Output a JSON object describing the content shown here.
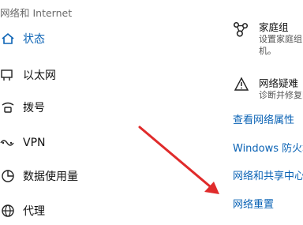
{
  "section_title": "网络和 Internet",
  "nav": {
    "items": [
      {
        "label": "状态",
        "icon": "home-icon",
        "active": true
      },
      {
        "label": "以太网",
        "icon": "ethernet-icon"
      },
      {
        "label": "拨号",
        "icon": "dialup-icon"
      },
      {
        "label": "VPN",
        "icon": "vpn-icon"
      },
      {
        "label": "数据使用量",
        "icon": "data-usage-icon"
      },
      {
        "label": "代理",
        "icon": "globe-icon"
      }
    ]
  },
  "homegroup": {
    "title": "家庭组",
    "sub1": "设置家庭组",
    "sub2": "机。"
  },
  "troubleshoot": {
    "title": "网络疑难",
    "sub": "诊断并修复网"
  },
  "links": {
    "view_properties": "查看网络属性",
    "firewall": "Windows 防火墙",
    "sharing_center": "网络和共享中心",
    "network_reset": "网络重置"
  },
  "colors": {
    "accent": "#0b63b5",
    "annotation_arrow": "#e02b2b"
  }
}
